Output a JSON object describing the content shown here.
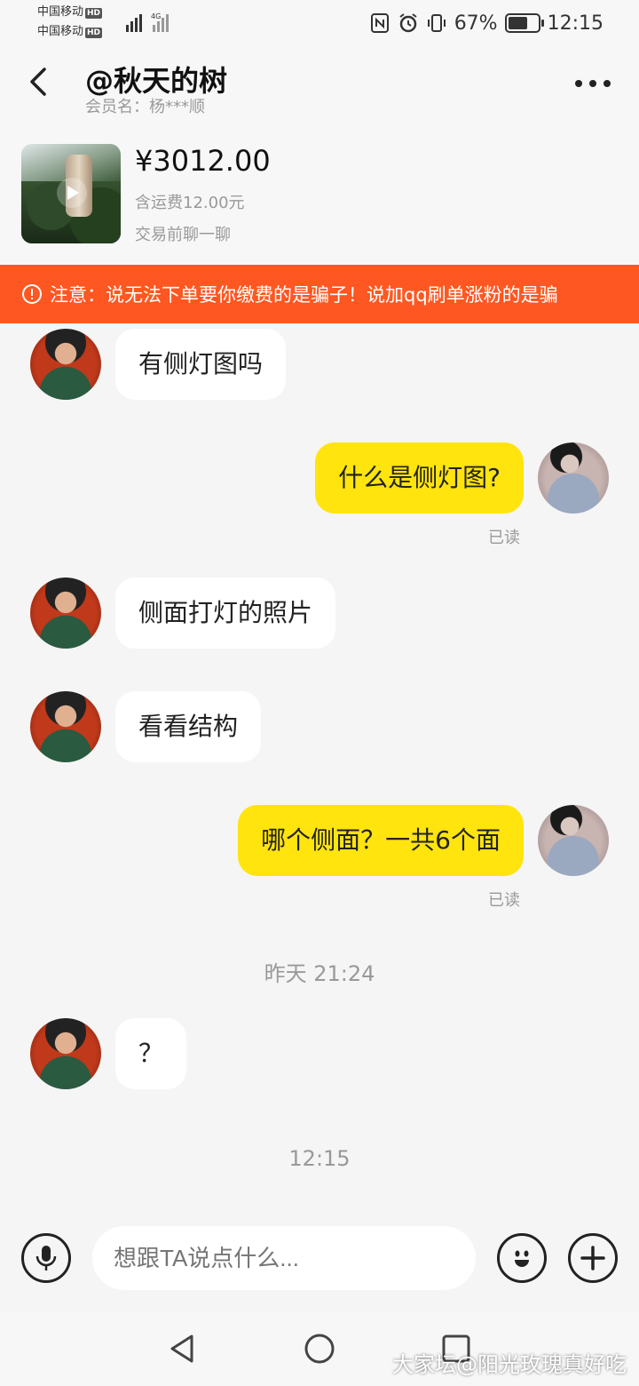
{
  "status_bar": {
    "carrier1": "中国移动",
    "carrier2": "中国移动",
    "hd": "HD",
    "network": "4G",
    "battery": "67%",
    "battery_level": 0.67,
    "time": "12:15"
  },
  "header": {
    "title": "@秋天的树",
    "subtitle": "会员名：杨***顺"
  },
  "product": {
    "price": "¥3012.00",
    "shipping": "含运费12.00元",
    "pre_chat": "交易前聊一聊"
  },
  "warning": {
    "text": "注意：说无法下单要你缴费的是骗子！说加qq刷单涨粉的是骗"
  },
  "messages": [
    {
      "from": "other",
      "text": "有侧灯图吗"
    },
    {
      "from": "me",
      "text": "什么是侧灯图?",
      "status": "已读"
    },
    {
      "from": "other",
      "text": "侧面打灯的照片"
    },
    {
      "from": "other",
      "text": "看看结构"
    },
    {
      "from": "me",
      "text": "哪个侧面？一共6个面",
      "status": "已读"
    },
    {
      "from": "other",
      "text": "？"
    }
  ],
  "timestamps": [
    "昨天 21:24",
    "12:15"
  ],
  "input": {
    "placeholder": "想跟TA说点什么..."
  },
  "watermark": "大家坛@阳光玫瑰真好吃",
  "colors": {
    "warning_bg": "#ff5722",
    "my_bubble": "#ffe40e",
    "other_bubble": "#ffffff",
    "background": "#f5f5f5"
  }
}
